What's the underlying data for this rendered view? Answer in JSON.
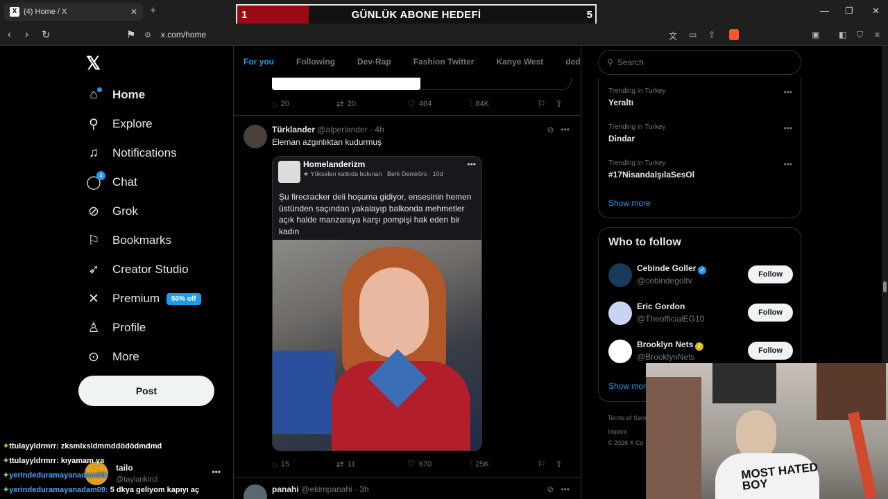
{
  "browser": {
    "tab_title": "(4) Home / X",
    "url": "x.com/home"
  },
  "overlay": {
    "goal_current": "1",
    "goal_label": "GÜNLÜK ABONE HEDEFİ",
    "goal_target": "5",
    "goal_progress": 0.2
  },
  "sidebar": {
    "items": [
      {
        "label": "Home",
        "icon": "home-icon"
      },
      {
        "label": "Explore",
        "icon": "search-icon"
      },
      {
        "label": "Notifications",
        "icon": "bell-icon"
      },
      {
        "label": "Chat",
        "icon": "chat-icon",
        "badge": "4"
      },
      {
        "label": "Grok",
        "icon": "grok-icon"
      },
      {
        "label": "Bookmarks",
        "icon": "bookmark-icon"
      },
      {
        "label": "Creator Studio",
        "icon": "rocket-icon"
      },
      {
        "label": "Premium",
        "icon": "x-icon",
        "pill": "50% off"
      },
      {
        "label": "Profile",
        "icon": "person-icon"
      },
      {
        "label": "More",
        "icon": "more-icon"
      }
    ],
    "post_label": "Post",
    "account_name": "tailo",
    "account_handle": "@taylankirci"
  },
  "chat_overlay": [
    {
      "user": "ttulayyldrmrr:",
      "msg": "zksmlxsldmmddödödmdmd"
    },
    {
      "user": "ttulayyldrmrr:",
      "msg": "kıyamam ya"
    },
    {
      "user": "yerindeduramayanadam09:",
      "msg": ""
    },
    {
      "user": "yerindeduramayanadam09:",
      "msg": "5 dkya geliyom kapıyı aç"
    }
  ],
  "feed": {
    "tabs": [
      "For you",
      "Following",
      "Dev-Rap",
      "Fashion Twitter",
      "Kanye West",
      "dedeKon"
    ],
    "prev_stats": {
      "replies": "20",
      "reposts": "20",
      "likes": "464",
      "views": "84K"
    },
    "tweet1": {
      "name": "Türklander",
      "handle": "@alperlander",
      "time": "4h",
      "text": "Eleman azgınlıktan kudurmuş",
      "quote": {
        "name": "Homelanderizm",
        "sub": "Yükselen katkıda bulunan",
        "author": "Berk Demirörs",
        "time": "10d",
        "text": "Şu firecracker deli hoşuma gidiyor, ensesinin hemen üstünden saçından yakalayıp balkonda mehmetler açık halde manzaraya karşı pompişi hak eden bir kadın"
      },
      "stats": {
        "replies": "15",
        "reposts": "11",
        "likes": "670",
        "views": "25K"
      }
    },
    "tweet2": {
      "name": "panahi",
      "handle": "@ekimpanahi",
      "time": "3h"
    }
  },
  "right": {
    "search_placeholder": "Search",
    "trends": [
      {
        "context": "Trending in Turkey",
        "topic": "Yeraltı"
      },
      {
        "context": "Trending in Turkey",
        "topic": "Dindar"
      },
      {
        "context": "Trending in Turkey",
        "topic": "#17NisandaIşılaSesOl"
      }
    ],
    "show_more": "Show more",
    "who_title": "Who to follow",
    "follow_label": "Follow",
    "who": [
      {
        "name": "Cebinde Goller",
        "handle": "@cebindegoltv",
        "verified": "#1d9bf0"
      },
      {
        "name": "Eric Gordon",
        "handle": "@TheofficialEG10",
        "verified": ""
      },
      {
        "name": "Brooklyn Nets",
        "handle": "@BrooklynNets",
        "verified": "#e2b719"
      }
    ],
    "show_more_2": "Show more",
    "footer_1": "Terms of Servi",
    "footer_2": "Imprint",
    "footer_3": "© 2026 X Co"
  },
  "webcam": {
    "shirt_text": "MOST HATED BOY"
  }
}
